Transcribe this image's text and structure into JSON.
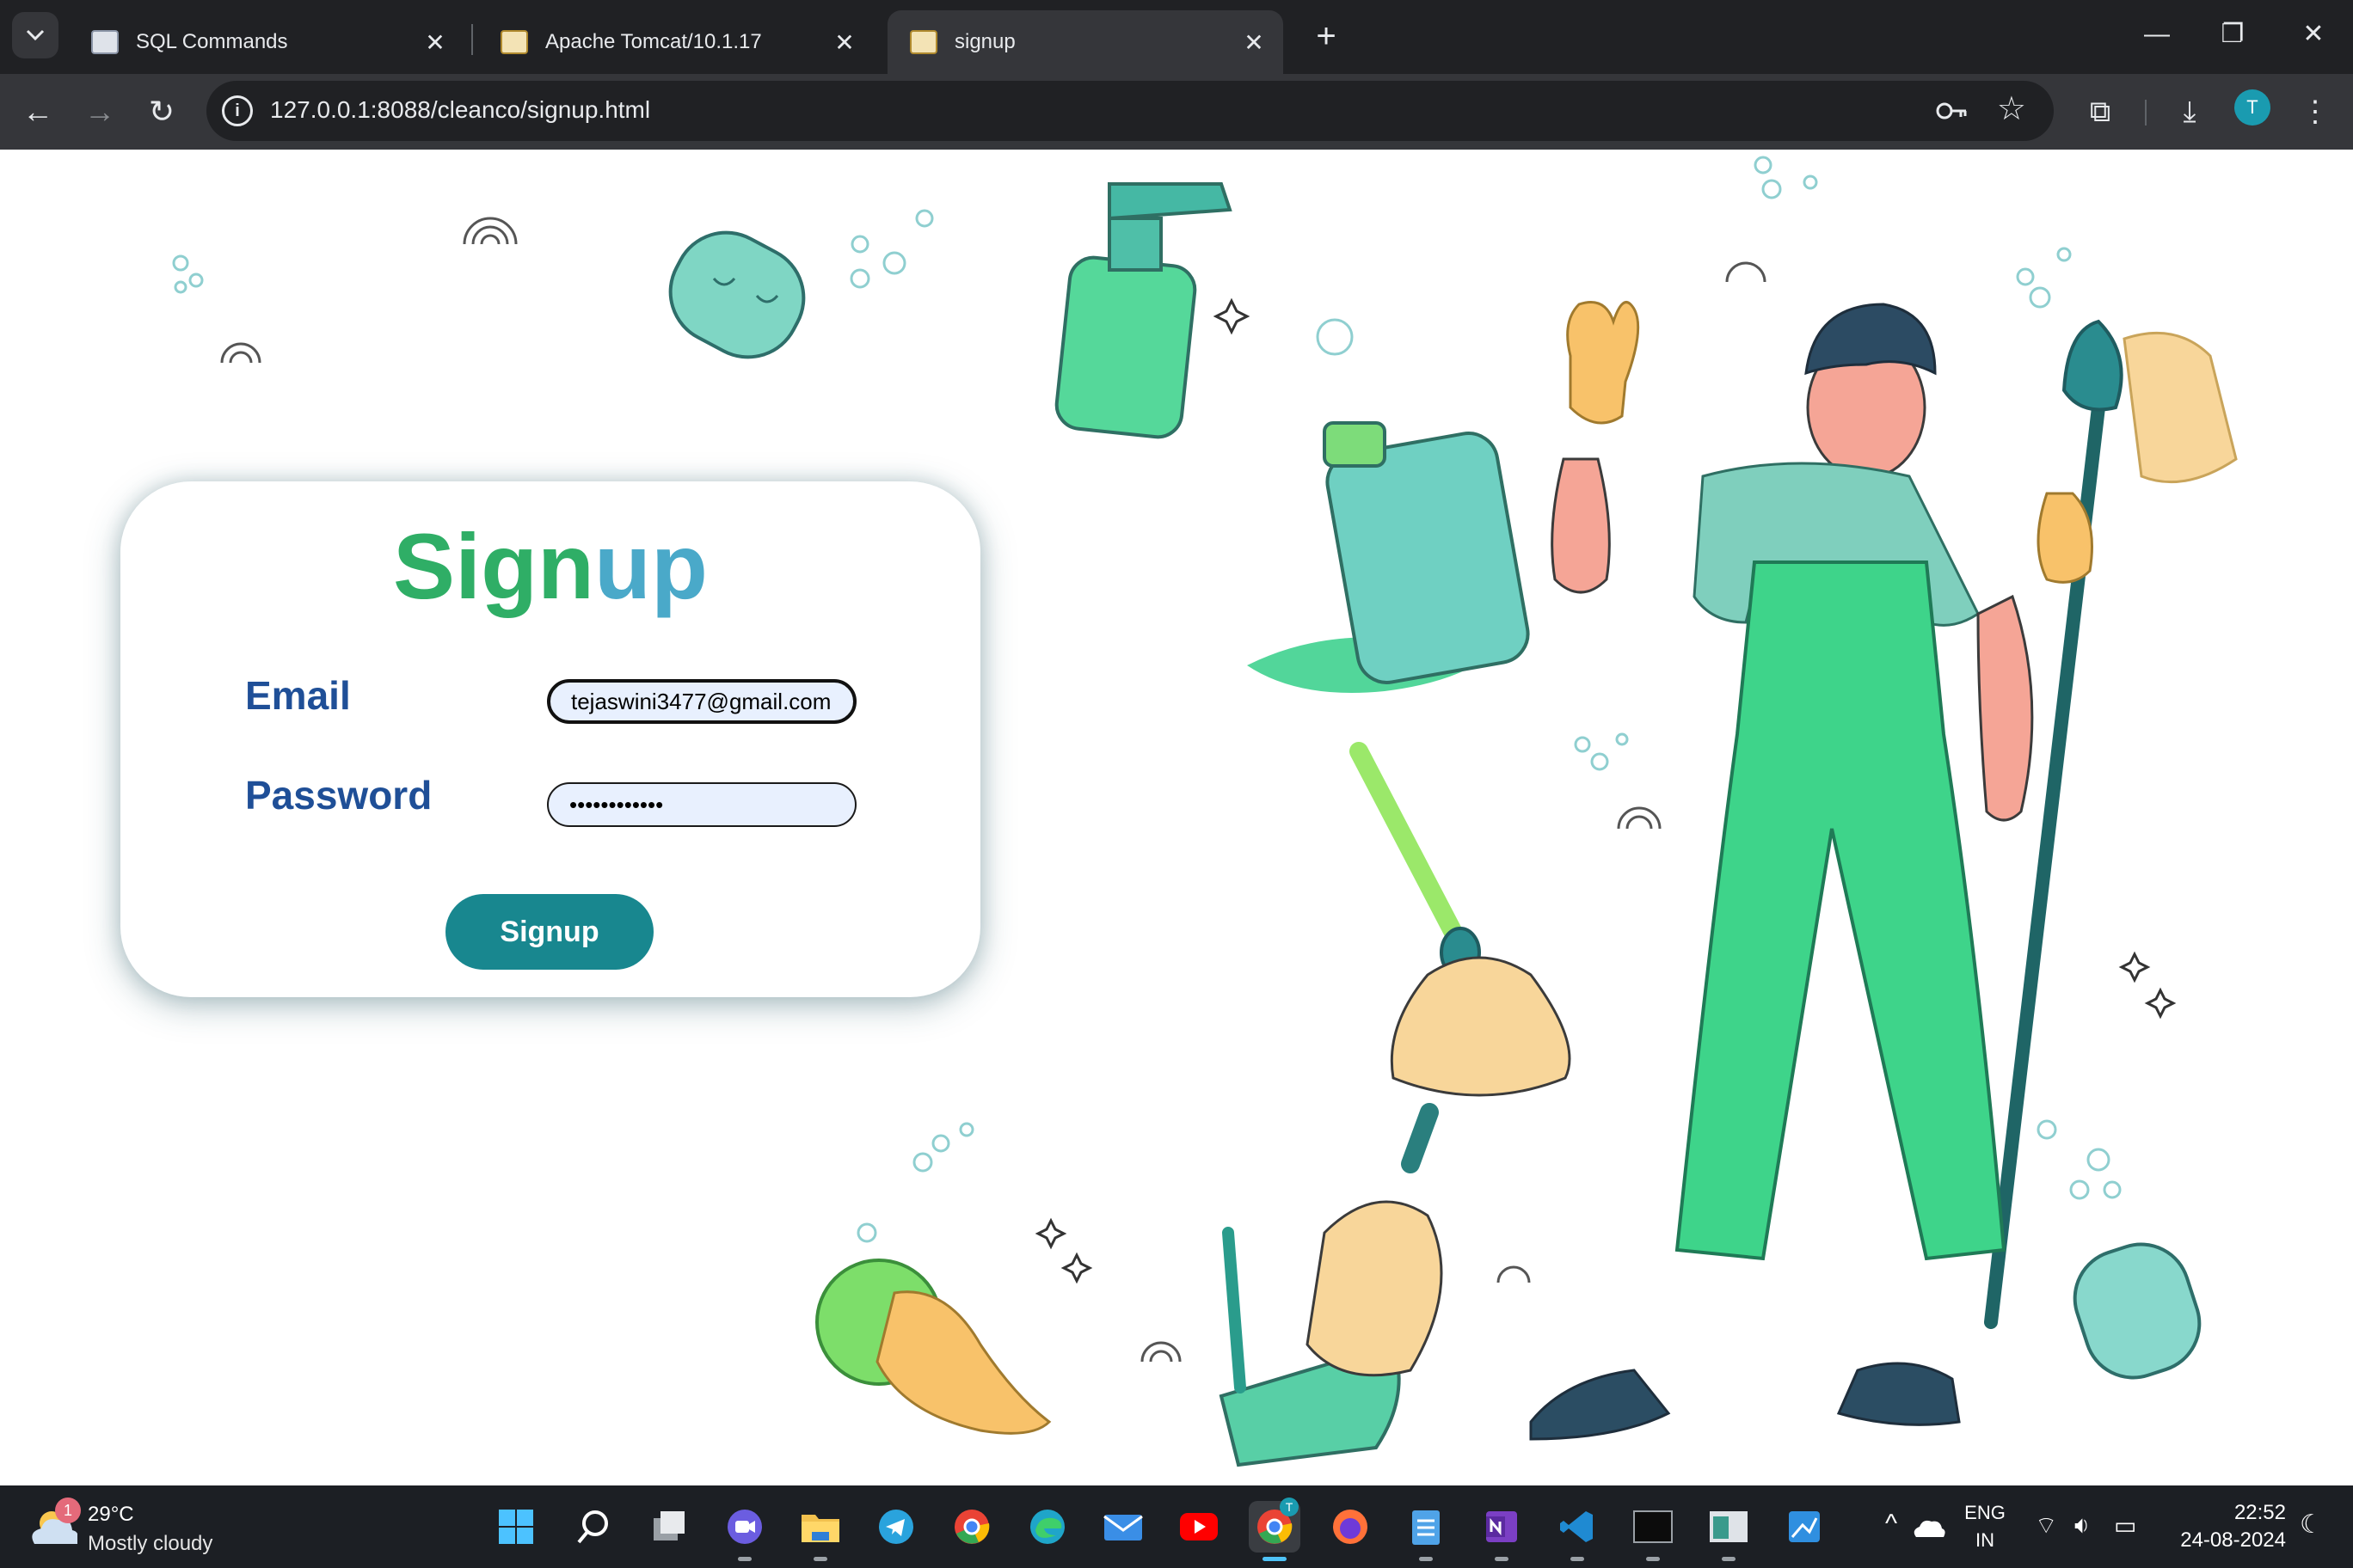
{
  "browser": {
    "tabs": [
      {
        "title": "SQL Commands",
        "active": false
      },
      {
        "title": "Apache Tomcat/10.1.17",
        "active": false
      },
      {
        "title": "signup",
        "active": true
      }
    ],
    "address_bar": {
      "url": "127.0.0.1:8088/cleanco/signup.html"
    },
    "profile_initial": "T",
    "new_tab_label": "+"
  },
  "signup_form": {
    "heading_part1": "Sign",
    "heading_part2": "up",
    "email_label": "Email",
    "email_value": "tejaswini3477@gmail.com",
    "password_label": "Password",
    "password_value": "••••••••••••",
    "submit_label": "Signup"
  },
  "taskbar": {
    "weather": {
      "temp": "29°C",
      "condition": "Mostly cloudy",
      "badge": "1"
    },
    "language": {
      "line1": "ENG",
      "line2": "IN"
    },
    "clock": {
      "time": "22:52",
      "date": "24-08-2024"
    },
    "chrome_badge": "T"
  },
  "colors": {
    "accent_teal": "#18878f",
    "heading_green": "#2fae66",
    "heading_blue": "#4aa9c9",
    "label_blue": "#1f4f97"
  }
}
